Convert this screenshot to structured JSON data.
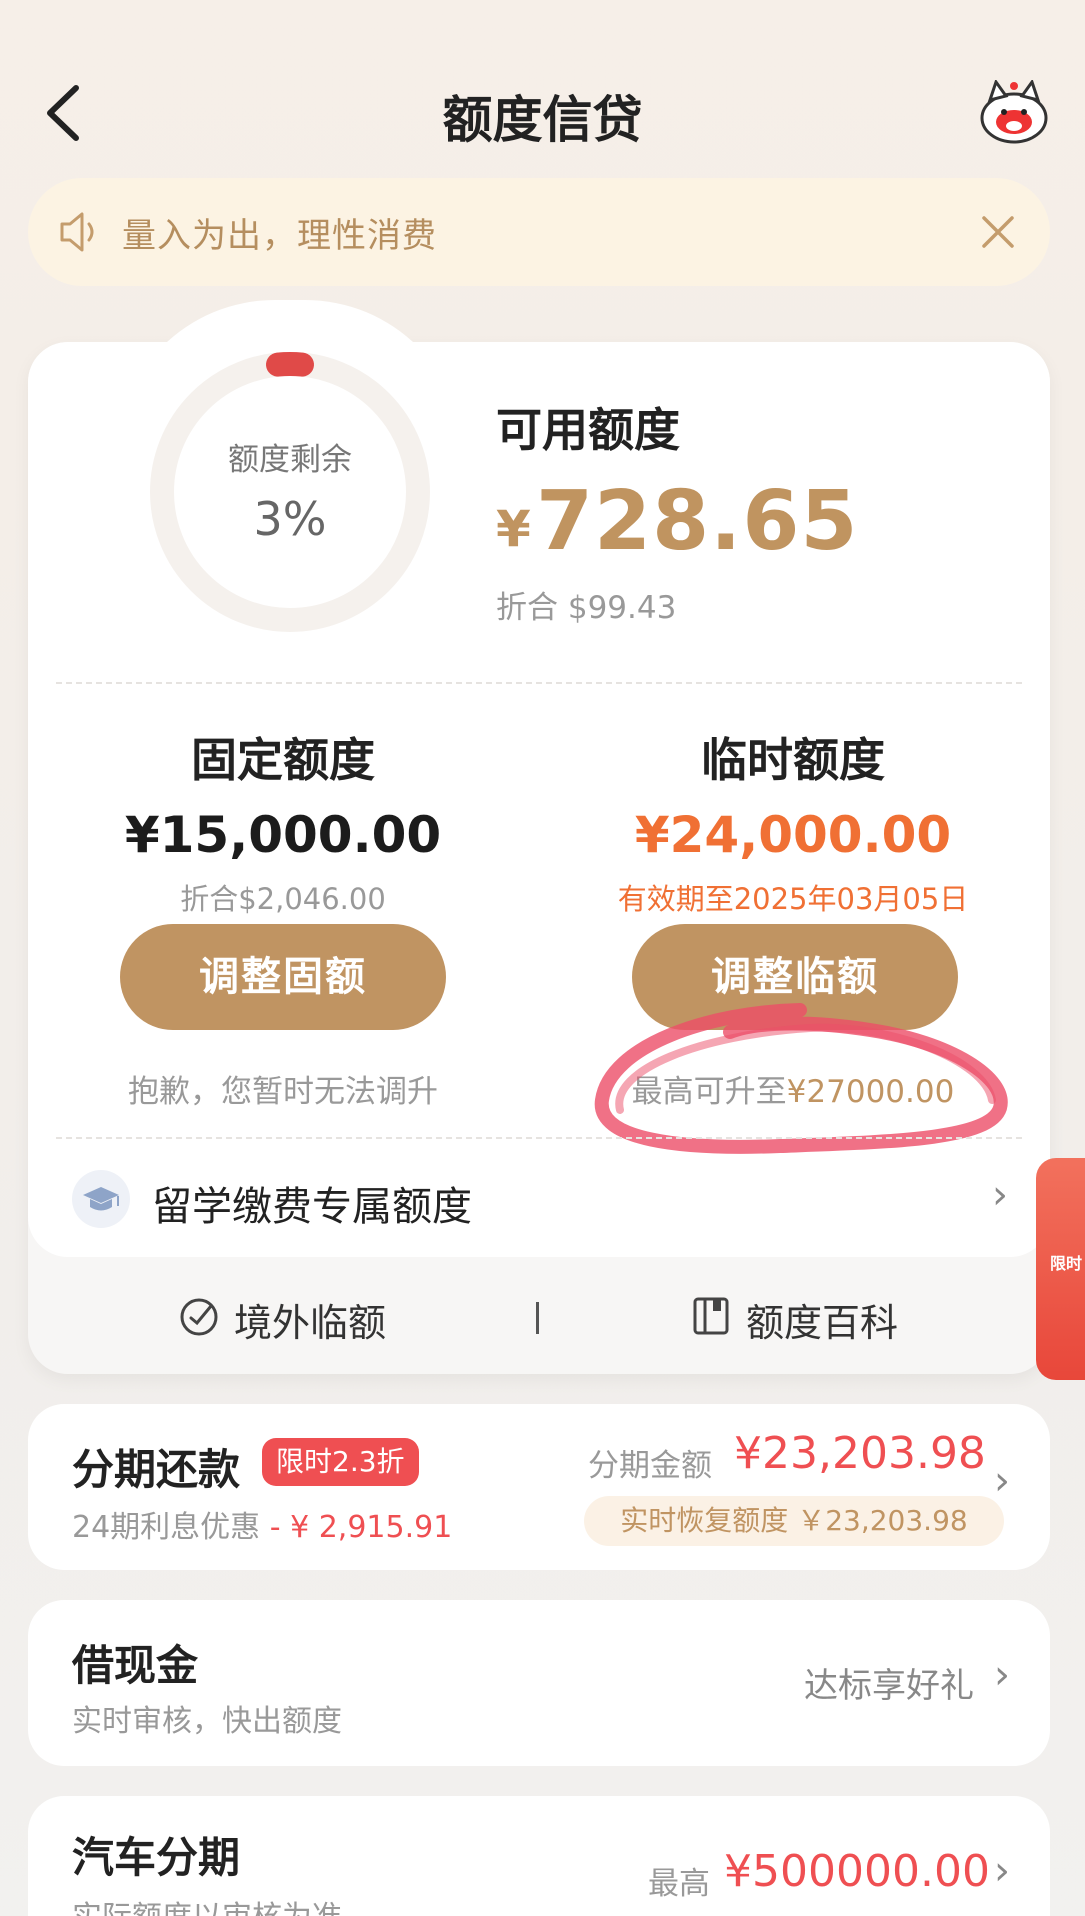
{
  "header": {
    "title": "额度信贷"
  },
  "notice": {
    "text": "量入为出，理性消费"
  },
  "quota": {
    "ring_label": "额度剩余",
    "ring_value": "3%",
    "ring_fraction": 0.03,
    "available_title": "可用额度",
    "currency": "¥",
    "available_amount": "728.65",
    "available_usd": "折合 $99.43"
  },
  "fixed": {
    "title": "固定额度",
    "amount": "¥15,000.00",
    "usd": "折合$2,046.00",
    "button": "调整固额",
    "note": "抱歉，您暂时无法调升"
  },
  "temporary": {
    "title": "临时额度",
    "amount": "¥24,000.00",
    "valid": "有效期至2025年03月05日",
    "button": "调整临额",
    "note_prefix": "最高可升至",
    "note_amount": "¥27000.00"
  },
  "study": {
    "label": "留学缴费专属额度"
  },
  "links": {
    "overseas": "境外临额",
    "wiki": "额度百科"
  },
  "promo_tab": {
    "text": "限时"
  },
  "installment": {
    "title": "分期还款",
    "badge": "限时2.3折",
    "sub_label": "24期利息优惠",
    "discount": "- ¥ 2,915.91",
    "amount_label": "分期金额",
    "amount": "¥23,203.98",
    "recover": "实时恢复额度 ￥23,203.98"
  },
  "cash": {
    "title": "借现金",
    "sub": "实时审核，快出额度",
    "right": "达标享好礼"
  },
  "car": {
    "title": "汽车分期",
    "sub": "实际额度以审核为准",
    "right_label": "最高",
    "amount": "¥500000.00"
  },
  "colors": {
    "accent_gold": "#c09462",
    "orange": "#f07034",
    "red": "#ef4f52"
  }
}
